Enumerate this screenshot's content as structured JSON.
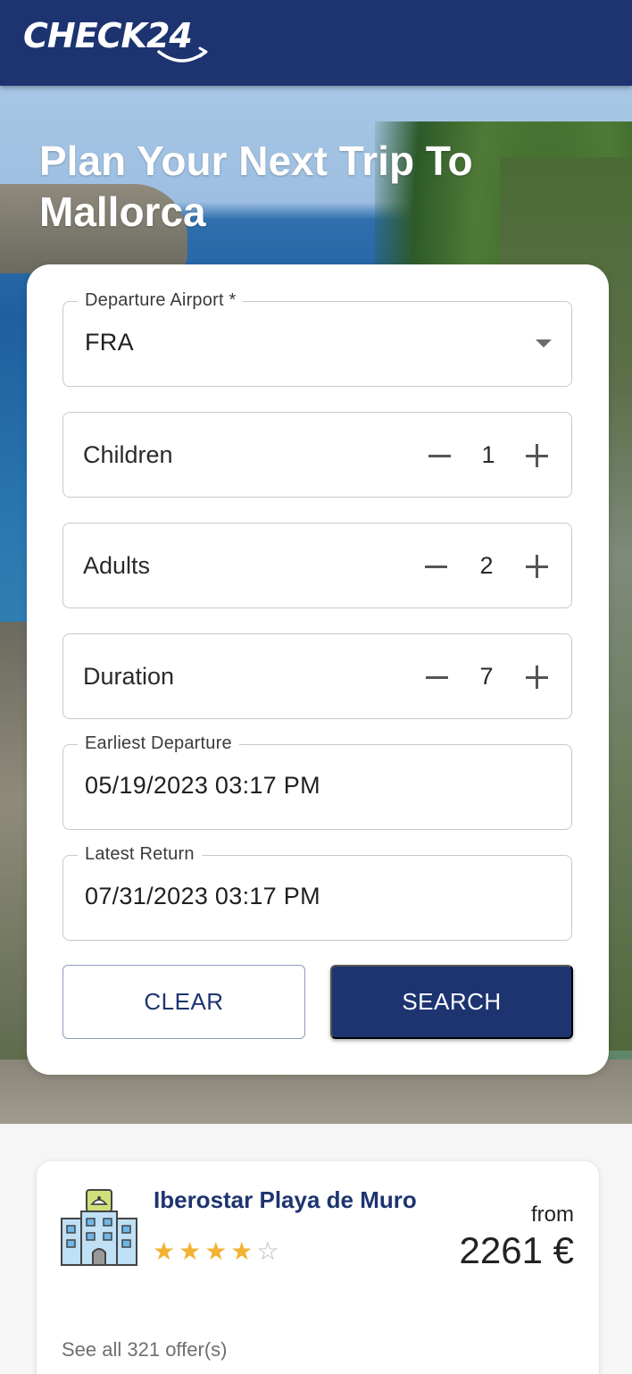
{
  "header": {
    "logo_text": "CHECK24",
    "brand_color": "#1d3471"
  },
  "hero": {
    "title": "Plan Your Next Trip To Mallorca"
  },
  "form": {
    "departure_airport": {
      "label": "Departure Airport *",
      "value": "FRA"
    },
    "children": {
      "label": "Children",
      "value": "1"
    },
    "adults": {
      "label": "Adults",
      "value": "2"
    },
    "duration": {
      "label": "Duration",
      "value": "7"
    },
    "earliest_departure": {
      "label": "Earliest Departure",
      "value": "05/19/2023 03:17 PM"
    },
    "latest_return": {
      "label": "Latest Return",
      "value": "07/31/2023 03:17 PM"
    },
    "clear_label": "CLEAR",
    "search_label": "SEARCH"
  },
  "offer": {
    "hotel_name": "Iberostar Playa de Muro",
    "stars_filled": "★★★★",
    "stars_empty": "☆",
    "rating": 4,
    "from_label": "from",
    "price": "2261 €",
    "see_all": "See all 321 offer(s)",
    "icon": "hotel-building-icon"
  }
}
